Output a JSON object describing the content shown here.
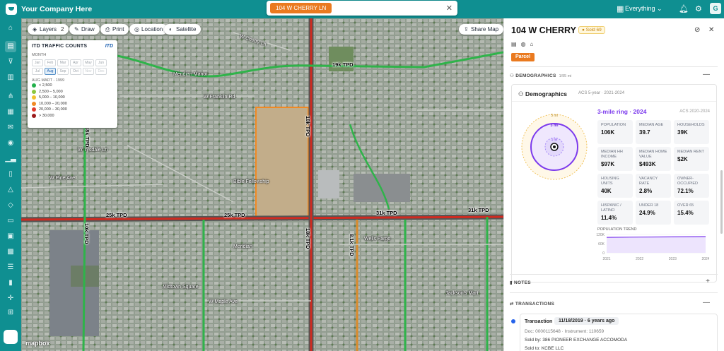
{
  "app": {
    "company": "Your Company Here",
    "active_tab": "104 W CHERRY LN",
    "scope": "Everything",
    "user_initial": "G"
  },
  "map": {
    "buttons": {
      "layers": "Layers",
      "layers_count": "2",
      "draw": "Draw",
      "print": "Print",
      "location": "Location",
      "satellite": "Satellite",
      "share": "Share Map"
    },
    "attribution": "mapbox",
    "traffic_labels": [
      "19k TPD",
      "18k TPD",
      "25k TPD",
      "25k TPD",
      "31k TPD",
      "31k TPD",
      "10k TPD",
      "18k TPD",
      "8.1k TPD",
      "18k TPD"
    ],
    "streets": [
      "W Cherry Ln",
      "W Pine Ave",
      "W Franklin Rd",
      "W Maple Ave",
      "W Tysdale Ln",
      "Meridian Manor",
      "Bible Fellowship",
      "Wells Fargo",
      "Meridian",
      "Midtown Square",
      "Jackson's Mart"
    ]
  },
  "itd": {
    "title": "ITD TRAFFIC COUNTS",
    "logo": "ITD",
    "month_label": "MONTH",
    "months": [
      "Jan",
      "Feb",
      "Mar",
      "Apr",
      "May",
      "Jun",
      "Jul",
      "Aug",
      "Sep",
      "Oct",
      "Nov",
      "Dec"
    ],
    "selected_month": "Aug",
    "legend_title": "AUG MADT - 1999",
    "legend": [
      {
        "label": "< 2,500",
        "color": "#22b04b"
      },
      {
        "label": "2,500 – 5,000",
        "color": "#8cc63f"
      },
      {
        "label": "5,000 – 10,000",
        "color": "#f2c12e"
      },
      {
        "label": "10,000 – 20,000",
        "color": "#f08a24"
      },
      {
        "label": "20,000 – 30,000",
        "color": "#e23a2e"
      },
      {
        "label": "> 30,000",
        "color": "#9b1b1b"
      }
    ]
  },
  "panel": {
    "address": "104 W CHERRY LN",
    "sold_badge": "Sold 69",
    "parcel_badge": "Parcel",
    "demographics_header": "DEMOGRAPHICS",
    "demographics_count": "1/95 mi",
    "notes_header": "NOTES",
    "transactions_header": "TRANSACTIONS",
    "demographics": {
      "title": "Demographics",
      "subtitle": "ACS 5-year · 2021-2024",
      "ring_title": "3-mile ring · 2024",
      "source": "ACS 2020-2024",
      "ring_labels": [
        "5 mi",
        "3 mi",
        "1 mi"
      ],
      "stats": [
        {
          "label": "Population",
          "value": "106K"
        },
        {
          "label": "Median Age",
          "value": "39.7"
        },
        {
          "label": "Households",
          "value": "39K"
        },
        {
          "label": "Median HH Income",
          "value": "$97K"
        },
        {
          "label": "Median Home Value",
          "value": "$493K"
        },
        {
          "label": "Median Rent",
          "value": "$2K"
        },
        {
          "label": "Housing Units",
          "value": "40K"
        },
        {
          "label": "Vacancy Rate",
          "value": "2.8%"
        },
        {
          "label": "Owner-Occupied",
          "value": "72.1%"
        },
        {
          "label": "Hispanic / Latino",
          "value": "11.4%"
        },
        {
          "label": "Under 18",
          "value": "24.9%"
        },
        {
          "label": "Over 65",
          "value": "15.4%"
        }
      ],
      "trend_title": "POPULATION TREND",
      "trend_y_labels": [
        "120K",
        "60K",
        "0"
      ],
      "trend_x_labels": [
        "2021",
        "2022",
        "2023",
        "2024"
      ],
      "trend_values": [
        101000,
        103000,
        104500,
        106000
      ]
    },
    "transaction": {
      "label": "Transaction",
      "date": "11/18/2019 · 6 years ago",
      "doc": "Doc: 0000115648 · Instrument: 110659",
      "sold_by": "Sold by: 386 PIONEER EXCHANGE ACCOMODA",
      "sold_to": "Sold to: KCBE LLC"
    }
  }
}
